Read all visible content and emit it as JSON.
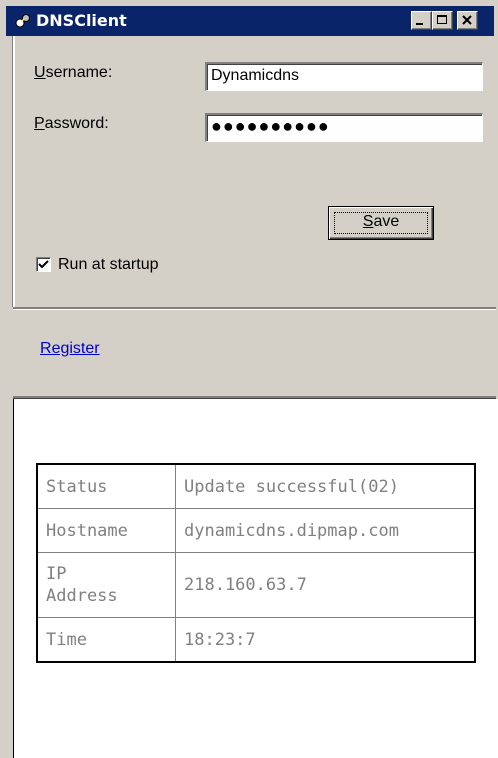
{
  "window": {
    "title": "DNSClient",
    "icon": "app-network-icon",
    "controls": [
      "minimize-icon",
      "maximize-icon",
      "close-icon"
    ]
  },
  "form": {
    "username_label_access": "U",
    "username_label_rest": "sername:",
    "username_value": "Dynamicdns",
    "password_label_access": "P",
    "password_label_rest": "assword:",
    "password_value": "●●●●●●●●●●",
    "run_at_startup_label": "Run at startup",
    "run_at_startup_checked": true,
    "save_access": "S",
    "save_rest": "ave"
  },
  "links": {
    "register_access": "R",
    "register_rest": "egister"
  },
  "status_table": {
    "rows": [
      {
        "key": "Status",
        "value": "Update successful(02)"
      },
      {
        "key": "Hostname",
        "value": "dynamicdns.dipmap.com"
      },
      {
        "key_line1": "IP",
        "key_line2": "Address",
        "value": "218.160.63.7"
      },
      {
        "key": "Time",
        "value": "18:23:7"
      }
    ]
  }
}
